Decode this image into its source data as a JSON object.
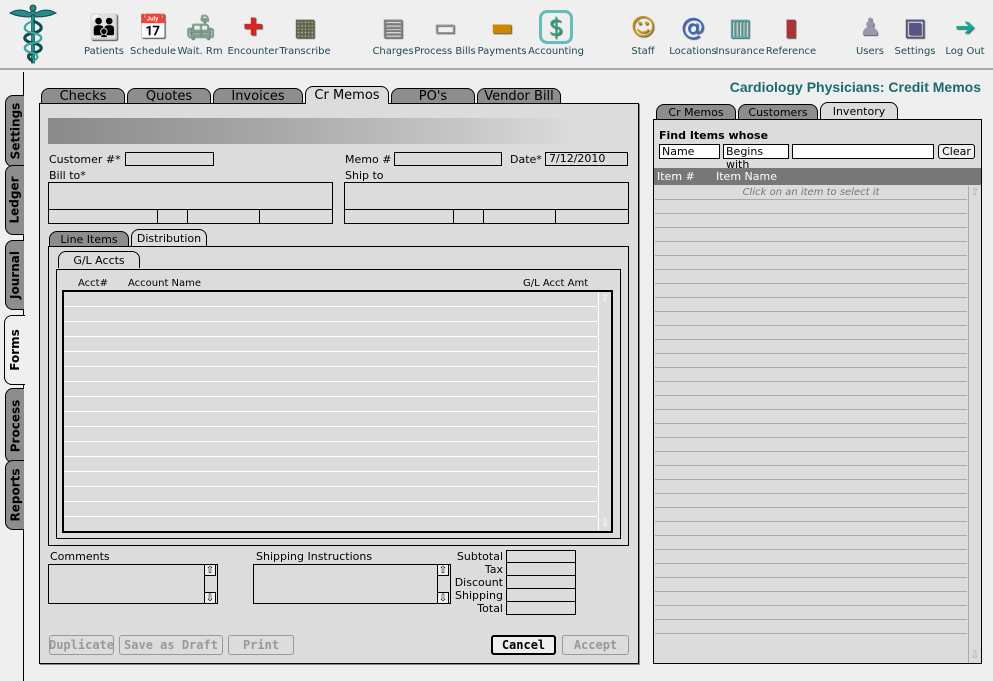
{
  "toolbar": {
    "logo": "caduceus-logo",
    "items": [
      {
        "label": "Patients",
        "icon": "patients-icon"
      },
      {
        "label": "Schedule",
        "icon": "calendar-icon"
      },
      {
        "label": "Wait. Rm",
        "icon": "waiting-room-icon"
      },
      {
        "label": "Encounter",
        "icon": "first-aid-kit-icon"
      },
      {
        "label": "Transcribe",
        "icon": "cassette-icon"
      },
      {
        "label": "Charges",
        "icon": "calculator-icon"
      },
      {
        "label": "Process Bills",
        "icon": "paper-stack-icon"
      },
      {
        "label": "Payments",
        "icon": "credit-card-icon"
      },
      {
        "label": "Accounting",
        "icon": "money-icon"
      },
      {
        "label": "Staff",
        "icon": "nurse-icon"
      },
      {
        "label": "Locations",
        "icon": "address-book-icon"
      },
      {
        "label": "Insurance",
        "icon": "building-icon"
      },
      {
        "label": "Reference",
        "icon": "book-icon"
      },
      {
        "label": "Users",
        "icon": "user-icon"
      },
      {
        "label": "Settings",
        "icon": "file-cabinet-icon"
      },
      {
        "label": "Log Out",
        "icon": "exit-door-icon"
      }
    ],
    "active": "Accounting"
  },
  "side_tabs": [
    {
      "label": "Settings",
      "active": false
    },
    {
      "label": "Ledger",
      "active": false
    },
    {
      "label": "Journal",
      "active": false
    },
    {
      "label": "Forms",
      "active": true
    },
    {
      "label": "Process",
      "active": false
    },
    {
      "label": "Reports",
      "active": false
    }
  ],
  "page_title": "Cardiology Physicians:  Credit Memos",
  "form_tabs": [
    {
      "label": "Checks",
      "active": false
    },
    {
      "label": "Quotes",
      "active": false
    },
    {
      "label": "Invoices",
      "active": false
    },
    {
      "label": "Cr Memos",
      "active": true
    },
    {
      "label": "PO's",
      "active": false
    },
    {
      "label": "Vendor Bill",
      "active": false
    }
  ],
  "form": {
    "customer_label": "Customer #*",
    "customer_value": "",
    "memo_label": "Memo #",
    "memo_value": "",
    "date_label": "Date*",
    "date_value": "7/12/2010",
    "bill_to_label": "Bill to*",
    "ship_to_label": "Ship to",
    "sub_tabs": [
      {
        "label": "Line Items",
        "active": false
      },
      {
        "label": "Distribution",
        "active": true
      }
    ],
    "inner_tab": "G/L Accts",
    "grid_columns": [
      "Acct#",
      "Account Name",
      "G/L Acct Amt"
    ],
    "grid_rows": 15,
    "comments_label": "Comments",
    "shipping_instructions_label": "Shipping Instructions",
    "totals": [
      {
        "label": "Subtotal",
        "value": ""
      },
      {
        "label": "Tax",
        "value": ""
      },
      {
        "label": "Discount",
        "value": ""
      },
      {
        "label": "Shipping",
        "value": ""
      },
      {
        "label": "Total",
        "value": ""
      }
    ],
    "buttons": {
      "duplicate": "Duplicate",
      "save_draft": "Save as Draft",
      "print": "Print",
      "cancel": "Cancel",
      "accept": "Accept"
    }
  },
  "right_panel": {
    "tabs": [
      {
        "label": "Cr Memos",
        "active": false
      },
      {
        "label": "Customers",
        "active": false
      },
      {
        "label": "Inventory",
        "active": true
      }
    ],
    "find_title": "Find Items whose",
    "field_select": "Name",
    "operator_select": "Begins with",
    "search_value": "",
    "clear_label": "Clear",
    "columns": [
      "Item #",
      "Item Name"
    ],
    "placeholder_row": "Click on an item to select it",
    "row_count": 32
  }
}
